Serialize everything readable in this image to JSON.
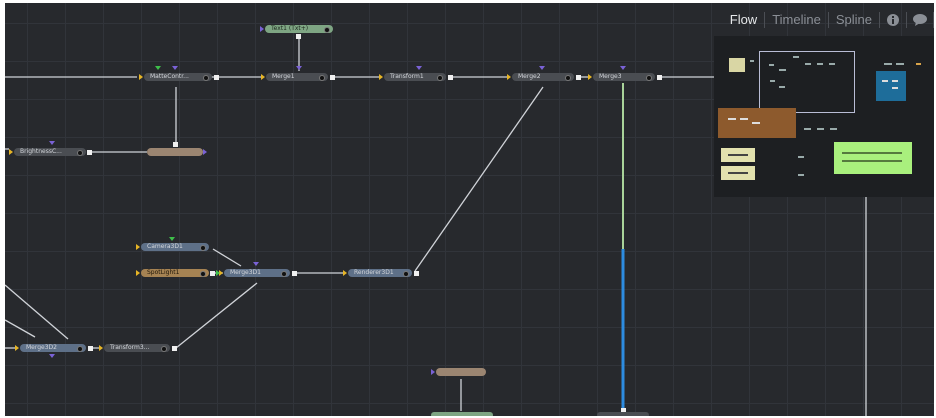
{
  "tabs": {
    "flow": "Flow",
    "timeline": "Timeline",
    "spline": "Spline"
  },
  "icons": {
    "info": "info-icon",
    "comments": "speech-bubble-icon"
  },
  "nodes": {
    "text1": "Text1 (Txt+)",
    "matte_control": "MatteContr...",
    "merge1": "Merge1",
    "transform1": "Transform1",
    "merge2": "Merge2",
    "merge3": "Merge3",
    "brightness": "BrightnessC...",
    "camera3d1": "Camera3D1",
    "spotlight1": "SpotLight1",
    "merge3d1": "Merge3D1",
    "renderer3d1": "Renderer3D1",
    "merge3d2": "Merge3D2",
    "transform3d": "Transform3..."
  },
  "colors": {
    "canvas": "#27292d",
    "grid": "#31343a",
    "wire": "#d0d3d8",
    "wire_green": "#a9d39a",
    "wire_blue": "#2d8ce0",
    "port_yellow": "#e7b526",
    "port_purple": "#7a62d6",
    "port_green": "#3ec04a"
  }
}
